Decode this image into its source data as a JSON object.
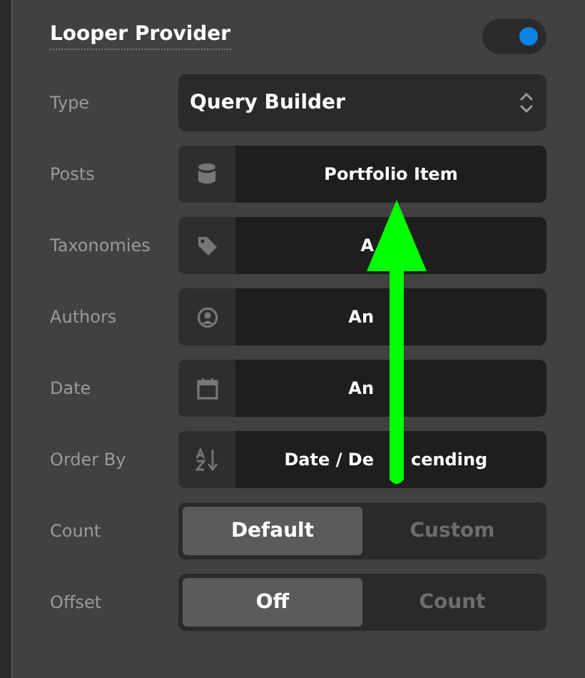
{
  "panel": {
    "title": "Looper Provider",
    "enabled": true
  },
  "rows": [
    {
      "kind": "select",
      "label": "Type",
      "value": "Query Builder"
    },
    {
      "kind": "picker",
      "label": "Posts",
      "value": "Portfolio Item"
    },
    {
      "kind": "picker",
      "label": "Taxonomies",
      "value_parts": [
        "A"
      ]
    },
    {
      "kind": "picker",
      "label": "Authors",
      "value_parts": [
        "An"
      ]
    },
    {
      "kind": "picker",
      "label": "Date",
      "value_parts": [
        "An"
      ]
    },
    {
      "kind": "picker",
      "label": "Order By",
      "value_parts": [
        "Date / De",
        "cending"
      ]
    },
    {
      "kind": "segmented",
      "label": "Count",
      "options": [
        {
          "label": "Default",
          "selected": true
        },
        {
          "label": "Custom",
          "selected": false
        }
      ]
    },
    {
      "kind": "segmented",
      "label": "Offset",
      "options": [
        {
          "label": "Off",
          "selected": true
        },
        {
          "label": "Count",
          "selected": false
        }
      ]
    }
  ],
  "annotation_arrow": true
}
